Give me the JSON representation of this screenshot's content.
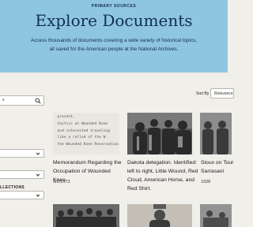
{
  "hero": {
    "eyebrow": "PRIMARY SOURCES",
    "title": "Explore Documents",
    "description": "Access thousands of documents covering a wide variety of historical topics, all saved for the American people at the National Archives."
  },
  "sidebar": {
    "search_value": "s",
    "collections_heading": "LLECTIONS"
  },
  "sort": {
    "label": "Sort By",
    "value": "Relevance"
  },
  "cards": [
    {
      "title": "Memorandum Regarding the Occupation of Wounded Knee",
      "date": "3/2/1973",
      "thumb_lines": [
        "  present,",
        "  tactics at Wounded Knee",
        "  and interested traveling",
        "  like a rolled of the W",
        "  the Wounded Knee Reservation"
      ]
    },
    {
      "title": "Dakota delegation. Identified: left to right, Little Wound, Red Cloud, American Horse, and Red Shirt.",
      "date": ""
    },
    {
      "title": "Sioux on Tour Sarrasani",
      "date": "1928"
    }
  ],
  "colors": {
    "hero_bg": "#8fc6df",
    "hero_text": "#112e58",
    "page_bg": "#f1efea"
  }
}
